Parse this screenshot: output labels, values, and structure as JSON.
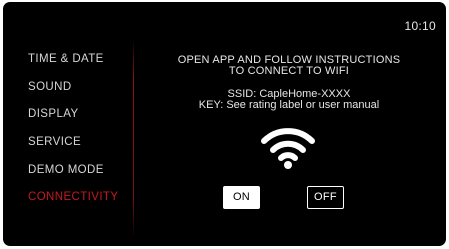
{
  "status": {
    "time": "10:10"
  },
  "sidebar": {
    "items": [
      {
        "label": "TIME & DATE"
      },
      {
        "label": "SOUND"
      },
      {
        "label": "DISPLAY"
      },
      {
        "label": "SERVICE"
      },
      {
        "label": "DEMO MODE"
      },
      {
        "label": "CONNECTIVITY",
        "active": true
      }
    ]
  },
  "connectivity": {
    "instruction_line1": "OPEN APP AND FOLLOW INSTRUCTIONS",
    "instruction_line2": "TO CONNECT TO WIFI",
    "ssid_text": "SSID: CapleHome-XXXX",
    "key_text": "KEY: See rating label or user manual",
    "icon": "wifi-icon",
    "on_label": "ON",
    "off_label": "OFF",
    "selected": "ON"
  },
  "colors": {
    "accent": "#c41a22",
    "background": "#000000",
    "text": "#ffffff"
  }
}
